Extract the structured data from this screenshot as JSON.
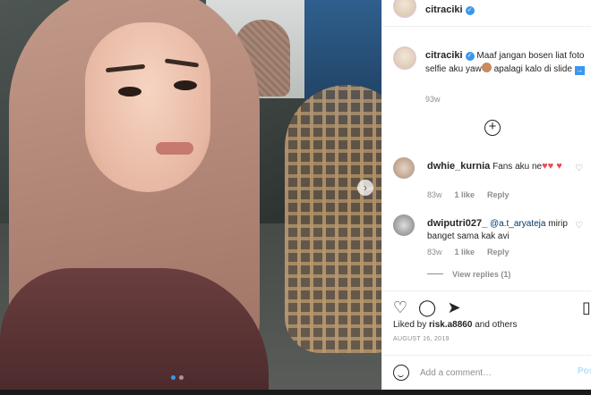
{
  "post": {
    "username": "citraciki",
    "verified_icon": "verified-badge-icon",
    "carousel_next_icon": "chevron-right-icon",
    "carousel": {
      "count": 2,
      "active_index": 0
    }
  },
  "caption": {
    "username": "citraciki",
    "text_part1": "Maaf jangan bosen liat foto selfie aku yaw",
    "text_part2": "apalagi kalo di slide",
    "emoji_icon": "see-no-evil-monkey-emoji",
    "arrow_icon": "right-arrow-emoji",
    "time": "93w"
  },
  "load_more_icon": "plus-circle-icon",
  "comments": [
    {
      "username": "dwhie_kurnia",
      "text": "Fans aku ne",
      "hearts": "♥♥ ♥",
      "time": "83w",
      "likes": "1 like",
      "reply": "Reply"
    },
    {
      "username": "dwiputri027_",
      "mention": "@a.t_aryateja",
      "text": "mirip banget sama kak avi",
      "time": "83w",
      "likes": "1 like",
      "reply": "Reply",
      "view_replies": "View replies (1)"
    }
  ],
  "actions": {
    "like_icon": "heart-icon",
    "comment_icon": "comment-icon",
    "share_icon": "paper-plane-icon",
    "save_icon": "bookmark-icon"
  },
  "likes": {
    "prefix": "Liked by",
    "user": "risk.a8860",
    "suffix": "and others"
  },
  "date": "AUGUST 16, 2019",
  "add_comment": {
    "placeholder": "Add a comment…",
    "post_label": "Post",
    "emoji_icon": "smiley-icon"
  }
}
